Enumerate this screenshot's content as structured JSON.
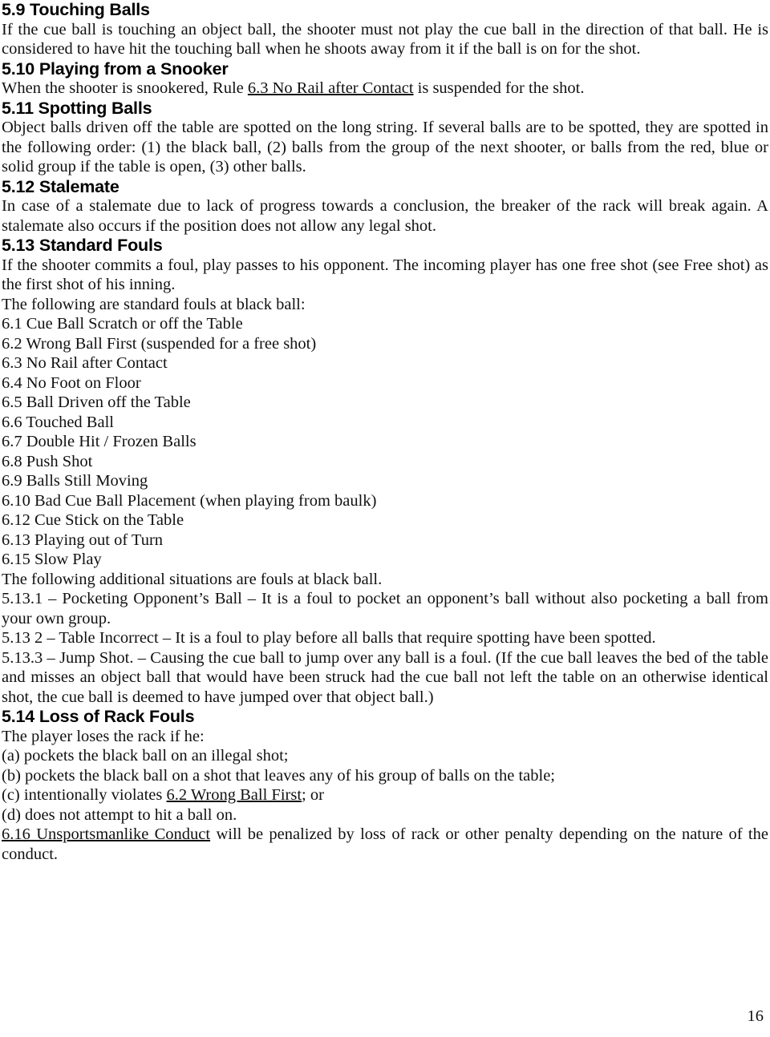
{
  "document": {
    "page_number": "16",
    "sections": [
      {
        "id": "5.9",
        "heading": "5.9 Touching Balls",
        "paragraphs": [
          "If the cue ball is touching an object ball, the shooter must not play the cue ball in the direction of that ball. He is considered to have hit the touching ball when he shoots away from it if the ball is on for the shot."
        ]
      },
      {
        "id": "5.10",
        "heading": "5.10 Playing from a Snooker",
        "paragraph_parts": {
          "before": "When the shooter is snookered, Rule ",
          "link": "6.3 No Rail after Contact",
          "after": " is suspended for the shot."
        }
      },
      {
        "id": "5.11",
        "heading": "5.11 Spotting Balls",
        "paragraphs": [
          "Object balls driven off the table are spotted on the long string. If several balls are to be spotted, they are spotted in the following order: (1) the black ball, (2) balls from the group of the next shooter, or balls from the red, blue or solid group if the table is open, (3) other balls."
        ]
      },
      {
        "id": "5.12",
        "heading": "5.12 Stalemate",
        "paragraphs": [
          "In case of a stalemate due to lack of progress towards a conclusion, the breaker of the rack will break again. A stalemate also occurs if the position does not allow any legal shot."
        ]
      },
      {
        "id": "5.13",
        "heading": "5.13 Standard Fouls",
        "paragraphs": [
          "If the shooter commits a foul, play passes to his opponent. The incoming player has one free shot (see Free shot) as the first shot of his inning.",
          "The following are standard fouls at black ball:"
        ],
        "foul_list": [
          "6.1 Cue Ball Scratch or off the Table",
          "6.2 Wrong Ball First (suspended for a free shot)",
          "6.3 No Rail after Contact",
          "6.4 No Foot on Floor",
          "6.5 Ball Driven off the Table",
          "6.6 Touched Ball",
          "6.7 Double Hit / Frozen Balls",
          "6.8 Push Shot",
          "6.9 Balls Still Moving",
          "6.10 Bad Cue Ball Placement (when playing from baulk)",
          "6.12 Cue Stick on the Table",
          "6.13 Playing out of Turn",
          "6.15 Slow Play"
        ],
        "additional_intro": "The following additional situations are fouls at black ball.",
        "additional_items": [
          "5.13.1 – Pocketing Opponent’s Ball – It is a foul to pocket an opponent’s ball without also pocketing a ball from your own group.",
          "5.13 2 – Table Incorrect – It is a foul to play before all balls that require spotting have been spotted.",
          "5.13.3 – Jump Shot. – Causing the cue ball to jump over any ball is a foul. (If the cue ball leaves the bed of the table and misses an object ball that would have been struck had the cue ball not left the table on an otherwise identical shot, the cue ball is deemed to have jumped over that object ball.)"
        ]
      },
      {
        "id": "5.14",
        "heading": "5.14 Loss of Rack Fouls",
        "intro": "The player loses the rack if he:",
        "items": [
          "(a) pockets the black ball on an illegal shot;",
          "(b) pockets the black ball on a shot that leaves any of his group of balls on the table;"
        ],
        "item_c_parts": {
          "before": "(c) intentionally violates ",
          "link": "6.2 Wrong Ball First",
          "after": "; or"
        },
        "item_d": "(d) does not attempt to hit a ball on.",
        "closing_parts": {
          "link": "6.16 Unsportsmanlike Conduct",
          "after": " will be penalized by loss of rack or other penalty depending on the nature of the conduct."
        }
      }
    ]
  }
}
